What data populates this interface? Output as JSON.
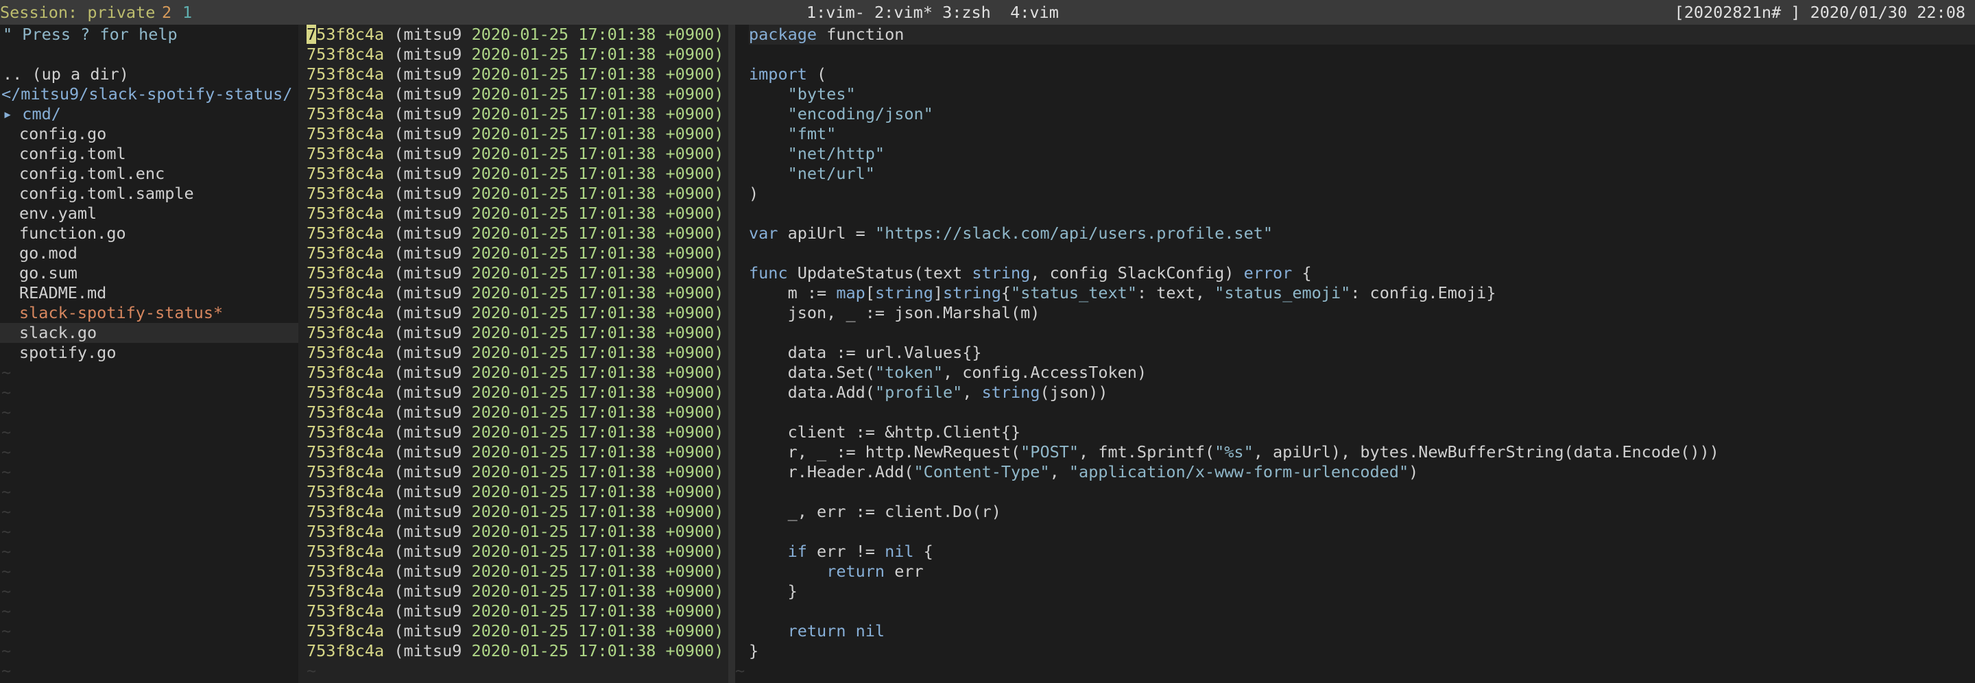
{
  "statusbar": {
    "session_label": "Session: private",
    "session_n1": "2",
    "session_n2": "1",
    "windows": "1:vim- 2:vim* 3:zsh  4:vim",
    "right": "[20202821n# ] 2020/01/30 22:08"
  },
  "tree": {
    "help": "\" Press ? for help",
    "up_dir": ".. (up a dir)",
    "current_dir": "</mitsu9/slack-spotify-status/",
    "cmd_dir": "▸ cmd/",
    "files": [
      "config.go",
      "config.toml",
      "config.toml.enc",
      "config.toml.sample",
      "env.yaml",
      "function.go",
      "go.mod",
      "go.sum",
      "README.md"
    ],
    "modified_file": "slack-spotify-status*",
    "selected_file": "slack.go",
    "last_file": "spotify.go",
    "tilde": "~"
  },
  "blame": {
    "hash": "753f8c4a",
    "author": "(mitsu9",
    "date": "2020-01-25 17:01:38 +0900)",
    "line_count": 32,
    "cursor_char": "7",
    "hash_rest": "53f8c4a",
    "tilde": "~"
  },
  "code": {
    "l1_kw": "package",
    "l1_name": " function",
    "l3_kw": "import",
    "l3_rest": " (",
    "imports": [
      "\"bytes\"",
      "\"encoding/json\"",
      "\"fmt\"",
      "\"net/http\"",
      "\"net/url\""
    ],
    "close_paren": ")",
    "l10_kw": "var",
    "l10_mid": " apiUrl = ",
    "l10_str": "\"https://slack.com/api/users.profile.set\"",
    "l12_kw": "func",
    "l12_mid1": " UpdateStatus(text ",
    "l12_type1": "string",
    "l12_mid2": ", config SlackConfig) ",
    "l12_type2": "error",
    "l12_end": " {",
    "l13_a": "    m := ",
    "l13_map": "map",
    "l13_b": "[",
    "l13_t1": "string",
    "l13_c": "]",
    "l13_t2": "string",
    "l13_d": "{",
    "l13_s1": "\"status_text\"",
    "l13_e": ": text, ",
    "l13_s2": "\"status_emoji\"",
    "l13_f": ": config.Emoji}",
    "l14": "    json, _ := json.Marshal(m)",
    "l16": "    data := url.Values{}",
    "l17_a": "    data.Set(",
    "l17_s": "\"token\"",
    "l17_b": ", config.AccessToken)",
    "l18_a": "    data.Add(",
    "l18_s": "\"profile\"",
    "l18_b": ", ",
    "l18_t": "string",
    "l18_c": "(json))",
    "l20": "    client := &http.Client{}",
    "l21_a": "    r, _ := http.NewRequest(",
    "l21_s1": "\"POST\"",
    "l21_b": ", fmt.Sprintf(",
    "l21_s2": "\"%s\"",
    "l21_c": ", apiUrl), bytes.NewBufferString(data.Encode()))",
    "l22_a": "    r.Header.Add(",
    "l22_s1": "\"Content-Type\"",
    "l22_b": ", ",
    "l22_s2": "\"application/x-www-form-urlencoded\"",
    "l22_c": ")",
    "l24": "    _, err := client.Do(r)",
    "l26_a": "    ",
    "l26_kw": "if",
    "l26_b": " err != ",
    "l26_nil": "nil",
    "l26_c": " {",
    "l27_a": "        ",
    "l27_kw": "return",
    "l27_b": " err",
    "l28": "    }",
    "l30_a": "    ",
    "l30_kw": "return",
    "l30_b": " ",
    "l30_nil": "nil",
    "l31": "}",
    "tilde": "~"
  }
}
